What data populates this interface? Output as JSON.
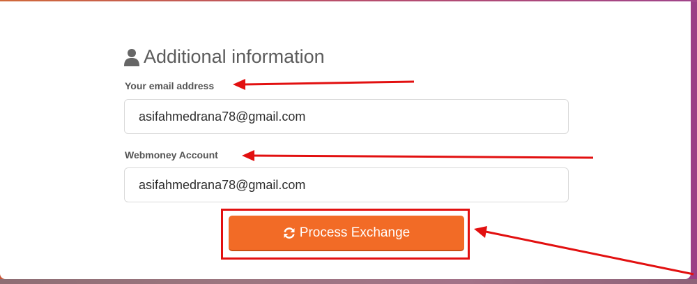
{
  "section": {
    "title": "Additional information",
    "icon": "user-icon"
  },
  "email_field": {
    "label": "Your email address",
    "value": "asifahmedrana78@gmail.com"
  },
  "webmoney_field": {
    "label": "Webmoney Account",
    "value": "asifahmedrana78@gmail.com"
  },
  "process_button": {
    "label": "Process Exchange",
    "icon": "refresh-icon",
    "color": "#f26b26"
  },
  "annotations": {
    "color": "#e21010"
  }
}
